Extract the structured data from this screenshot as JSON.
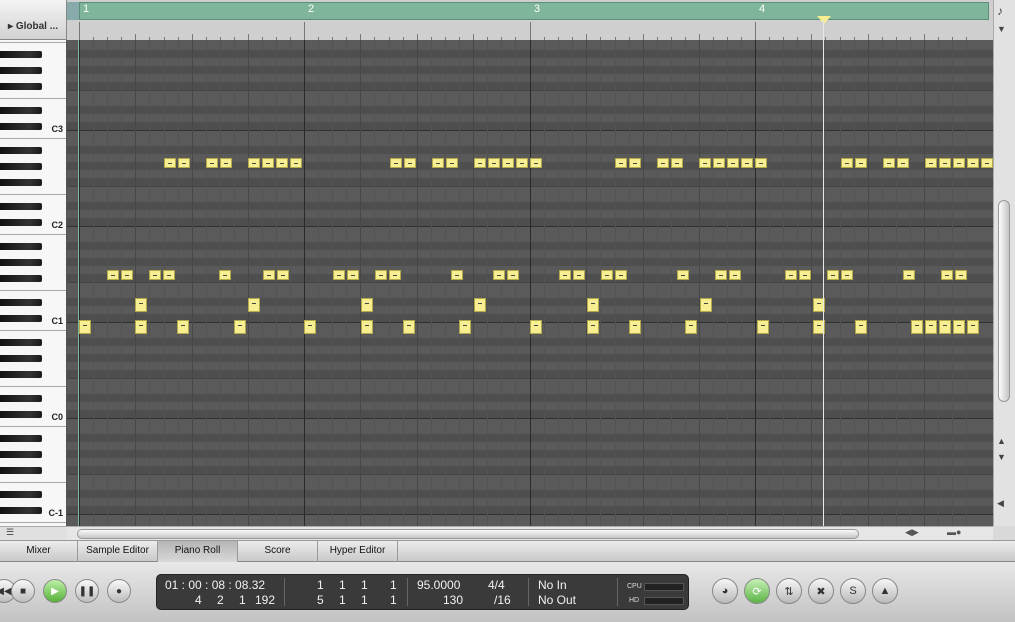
{
  "global_track": {
    "label": "Global ...",
    "disclosure_icon": "triangle-right-icon"
  },
  "ruler": {
    "bars": [
      "1",
      "2",
      "3",
      "4"
    ]
  },
  "keyboard": {
    "octave_labels": [
      "C3",
      "C2",
      "C1",
      "C0",
      "C-1"
    ]
  },
  "playhead": {
    "bar_position": 4.3
  },
  "tabs": [
    {
      "label": "Mixer",
      "active": false
    },
    {
      "label": "Sample Editor",
      "active": false
    },
    {
      "label": "Piano Roll",
      "active": true
    },
    {
      "label": "Score",
      "active": false
    },
    {
      "label": "Hyper Editor",
      "active": false
    }
  ],
  "transport": {
    "buttons": [
      "rewind-icon",
      "stop-icon",
      "play-icon",
      "pause-icon",
      "record-icon"
    ],
    "smpte_position": "01 : 00 : 08 : 08.32",
    "bar_position": [
      "4",
      "2",
      "1",
      "192"
    ],
    "locator_left": [
      "1",
      "1",
      "1",
      "1"
    ],
    "locator_right": [
      "5",
      "1",
      "1",
      "1"
    ],
    "tempo": "95.0000",
    "time_signature": "4/4",
    "project_end": "130",
    "division": "/16",
    "midi_in": "No In",
    "midi_out": "No Out",
    "meters": [
      "CPU",
      "HD"
    ],
    "right_buttons": [
      "tuner-icon",
      "cycle-icon",
      "replace-icon",
      "solo-icon",
      "sync-icon",
      "metronome-icon"
    ]
  },
  "colors": {
    "note_fill": "#f6ee91",
    "cycle": "#7fb59b",
    "grid_bg": "#5c5c5c"
  }
}
